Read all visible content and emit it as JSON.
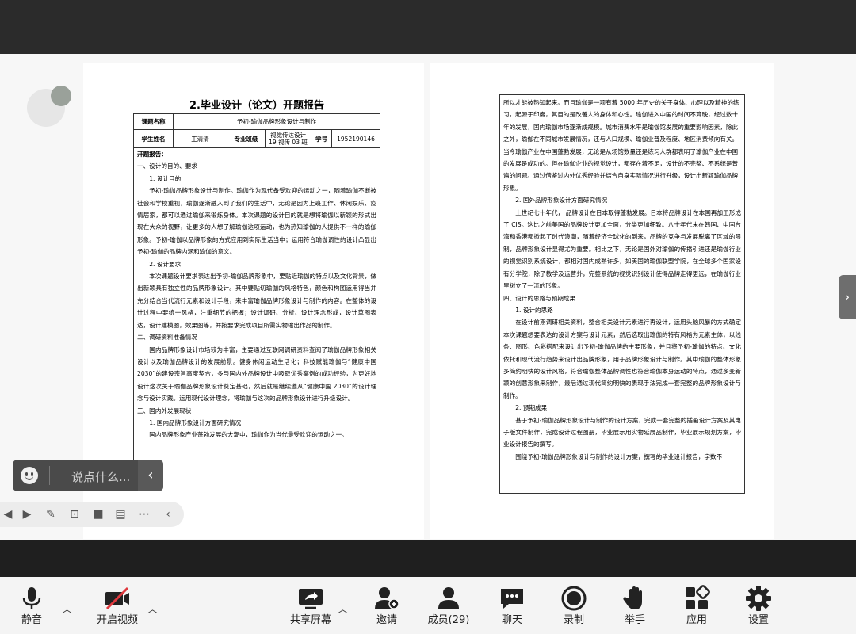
{
  "document": {
    "title": "2.毕业设计（论文）开题报告",
    "info": {
      "topic_label": "课题名称",
      "topic_value": "予初-瑜伽品牌形象设计与制作",
      "student_label": "学生姓名",
      "student_value": "王清清",
      "major_label": "专业班级",
      "major_value": "视觉传达设计 19 视传 03 班",
      "id_label": "学号",
      "id_value": "1952190146"
    },
    "left_lines": [
      {
        "cls": "bold",
        "text": "开题报告："
      },
      {
        "cls": "h1",
        "text": "一、设计的目的、要求"
      },
      {
        "cls": "h3",
        "text": "1. 设计目的"
      },
      {
        "cls": "para",
        "text": "予初-瑜伽品牌形象设计与制作。瑜伽作为现代备受欢迎的运动之一，随着瑜伽不断被社会和学校重视，瑜伽逐渐融入到了我们的生活中，无论是因为上班工作、休闲娱乐、疫情居家，都可以通过瑜伽来锻炼身体。本次课题的设计目的就是想将瑜伽以新颖的形式出现在大众的视野，让更多的人想了解瑜伽这项运动，也为热知瑜伽的人提供不一样的瑜伽形象。予初-瑜伽以品牌形象的方式应用到实际生活当中；运用符合瑜伽调性的设计凸显出予初-瑜伽的品牌内涵和瑜伽的意义。"
      },
      {
        "cls": "h3",
        "text": "2. 设计要求"
      },
      {
        "cls": "para",
        "text": "本次课题设计要求表达出予初-瑜伽品牌形象中，要贴近瑜伽的特点以及文化背景，做出新颖具有独立性的品牌形象设计。其中要贴切瑜伽的风格特色，颜色和构图运用得当并充分结合当代流行元素和设计手段，来丰富瑜伽品牌形象设计与制作的内容。在整体的设计过程中要统一风格，注重细节的把握；设计调研、分析、设计理念形成，设计草图表达，设计建模图，效果图等，并按要求完成项目所需实物输出作品的制作。"
      },
      {
        "cls": "h1",
        "text": "二、调研资料准备情况"
      },
      {
        "cls": "para",
        "text": "国内品牌形象设计市场较为丰富，主要通过互联网调研资料查阅了瑜伽品牌形象相关设计以及瑜伽品牌设计的发展前景。健身休闲运动生活化；科技赋能瑜伽与“健康中国 2030”的建设宗旨高度契合，多与国内外品牌设计中吸取优秀案例的成功经验，为更好地设计这次关于瑜伽品牌形象设计奠定基础，然后就是继续遵从“健康中国 2030”的设计理念与设计实践。运用现代设计理念，将瑜伽与这次的品牌形象设计进行升级设计。"
      },
      {
        "cls": "h1",
        "text": "三、国内外发展现状"
      },
      {
        "cls": "h3",
        "text": "1. 国内品牌形象设计方面研究情况"
      },
      {
        "cls": "para",
        "text": "国内品牌形象产业蓬勃发展的大潮中，瑜伽作为当代最受欢迎的运动之一。"
      }
    ],
    "right_lines": [
      {
        "cls": "",
        "text": "所以才能被热知起来。而且瑜伽是一项有着 5000 年历史的关于身体、心理以及精神的练习，起源于印度，其目的是改善人的身体和心性。瑜伽进入中国的时间不算晚，经过数十年的发展，国内瑜伽市场逐渐成规模。城市消费水平是瑜伽馆发展的重要影响因素，除此之外，瑜伽在不同城市发展情况，还与人口规模、瑜伽业普及程度、地区消费倾向有关。当今瑜伽产业在中国蓬勃发展，无论是从场馆数量还是练习人群都表明了瑜伽产业在中国的发展是成功的。但在瑜伽企业的视觉设计，都存在着不足，设计的不完整、不系统是普遍的问题。通过借鉴过内外优秀经验并结合自身实际情况进行升级，设计出新颖瑜伽品牌形象。"
      },
      {
        "cls": "h3",
        "text": "2. 国外品牌形象设计方面研究情况"
      },
      {
        "cls": "para",
        "text": "上世纪七十年代， 品牌设计在日本取得蓬勃发展。日本将品牌设计在本国再加工形成了 CIS。这比之前美国的品牌设计更加全面，分类更加细致。八十年代末在韩国、中国台湾和香港都掀起了时代浪潮，随着经济全球化的到来，品牌的竞争与发展脱离了区域的限制，品牌形象设计显得尤为重要。相比之下，无论是国外对瑜伽的传播引进还是瑜伽行业的视觉识别系统设计，都相对国内成熟许多，如美国的瑜伽联盟学院，在全球多个国家设有分学院，除了教学及运营外，完整系统的视觉识别设计使得品牌走得更远，在瑜伽行业里树立了一流的形象。"
      },
      {
        "cls": "h1",
        "text": "四、设计的思路与预期成果"
      },
      {
        "cls": "h3",
        "text": "1. 设计的思路"
      },
      {
        "cls": "para",
        "text": "在设计前期调研相关资料，整合相关设计元素进行再设计，运用头脑风暴的方式确定本次课题想要表达的设计方案与设计元素，然后选取出瑜伽的特有风格为元素主体，以线条、图形、色彩搭配来设计出予初-瑜伽品牌的主要形象，并且将予初-瑜伽的特点、文化依托和现代流行趋势来设计出品牌形象，用于品牌形象设计与制作。其中瑜伽的整体形象多简约明快的设计风格，符合瑜伽整体品牌调性也符合瑜伽本身运动的特点，通过多变新颖的创意形象来制作，最后通过现代简约明快的表现手法完成一套完整的品牌形象设计与制作。"
      },
      {
        "cls": "h3",
        "text": "2. 预期成果"
      },
      {
        "cls": "para",
        "text": "基于予初-瑜伽品牌形象设计与制作的设计方案，完成一套完整的插画设计方案及其电子版文件制作，完成设计过程图册，毕业展示用实物延展品制作，毕业展示规划方案，毕业设计报告的撰写。"
      },
      {
        "cls": "para",
        "text": "围绕予初-瑜伽品牌形象设计与制作的设计方案，撰写的毕业设计报告，字数不"
      }
    ]
  },
  "chat": {
    "placeholder": "说点什么..."
  },
  "toolbar": {
    "mute": "静音",
    "video": "开启视频",
    "share": "共享屏幕",
    "invite": "邀请",
    "members": "成员(29)",
    "chat": "聊天",
    "record": "录制",
    "raise": "举手",
    "apps": "应用",
    "settings": "设置"
  },
  "colors": {
    "toolbar_bg": "#f4f4f4",
    "dark_bar": "#2b2b2b",
    "video_off_red": "#e0393e"
  }
}
